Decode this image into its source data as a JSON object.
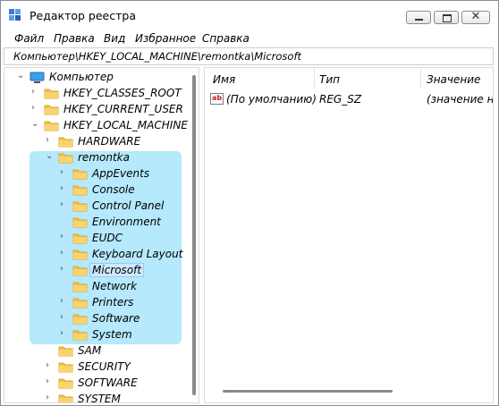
{
  "window": {
    "title": "Редактор реестра",
    "close_glyph": "✕"
  },
  "menu": {
    "items": [
      "Файл",
      "Правка",
      "Вид",
      "Избранное",
      "Справка"
    ]
  },
  "address": {
    "path": "Компьютер\\HKEY_LOCAL_MACHINE\\remontka\\Microsoft"
  },
  "tree": {
    "root_label": "Компьютер",
    "nodes": [
      {
        "label": "HKEY_CLASSES_ROOT",
        "arrow": "›"
      },
      {
        "label": "HKEY_CURRENT_USER",
        "arrow": "›"
      },
      {
        "label": "HKEY_LOCAL_MACHINE",
        "arrow": "⌄"
      },
      {
        "label": "HARDWARE",
        "arrow": "›"
      },
      {
        "label": "remontka",
        "arrow": "⌄"
      },
      {
        "label": "AppEvents",
        "arrow": "›"
      },
      {
        "label": "Console",
        "arrow": "›"
      },
      {
        "label": "Control Panel",
        "arrow": "›"
      },
      {
        "label": "Environment",
        "arrow": ""
      },
      {
        "label": "EUDC",
        "arrow": "›"
      },
      {
        "label": "Keyboard Layout",
        "arrow": "›"
      },
      {
        "label": "Microsoft",
        "arrow": "›"
      },
      {
        "label": "Network",
        "arrow": ""
      },
      {
        "label": "Printers",
        "arrow": "›"
      },
      {
        "label": "Software",
        "arrow": "›"
      },
      {
        "label": "System",
        "arrow": "›"
      },
      {
        "label": "SAM",
        "arrow": ""
      },
      {
        "label": "SECURITY",
        "arrow": "›"
      },
      {
        "label": "SOFTWARE",
        "arrow": "›"
      },
      {
        "label": "SYSTEM",
        "arrow": "›"
      }
    ],
    "root_arrow": "⌄",
    "selected": "Microsoft"
  },
  "list": {
    "columns": [
      "Имя",
      "Тип",
      "Значение"
    ],
    "rows": [
      {
        "icon": "ab",
        "name": "(По умолчанию)",
        "type": "REG_SZ",
        "value": "(значение не"
      }
    ]
  },
  "colors": {
    "highlight": "#b5e9fb",
    "folder": "#f2c14e"
  }
}
